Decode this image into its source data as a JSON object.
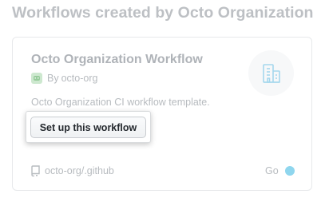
{
  "section": {
    "heading": "Workflows created by Octo Organization"
  },
  "workflow_card": {
    "title": "Octo Organization Workflow",
    "creator_prefix": "By",
    "creator_name": "octo-org",
    "description": "Octo Organization CI workflow template.",
    "setup_button_label": "Set up this workflow",
    "repository": "octo-org/.github",
    "language": "Go",
    "language_color": "#8fd6ee",
    "category_icon": "building-icon",
    "accent_icon_color": "#a5d7ed"
  }
}
